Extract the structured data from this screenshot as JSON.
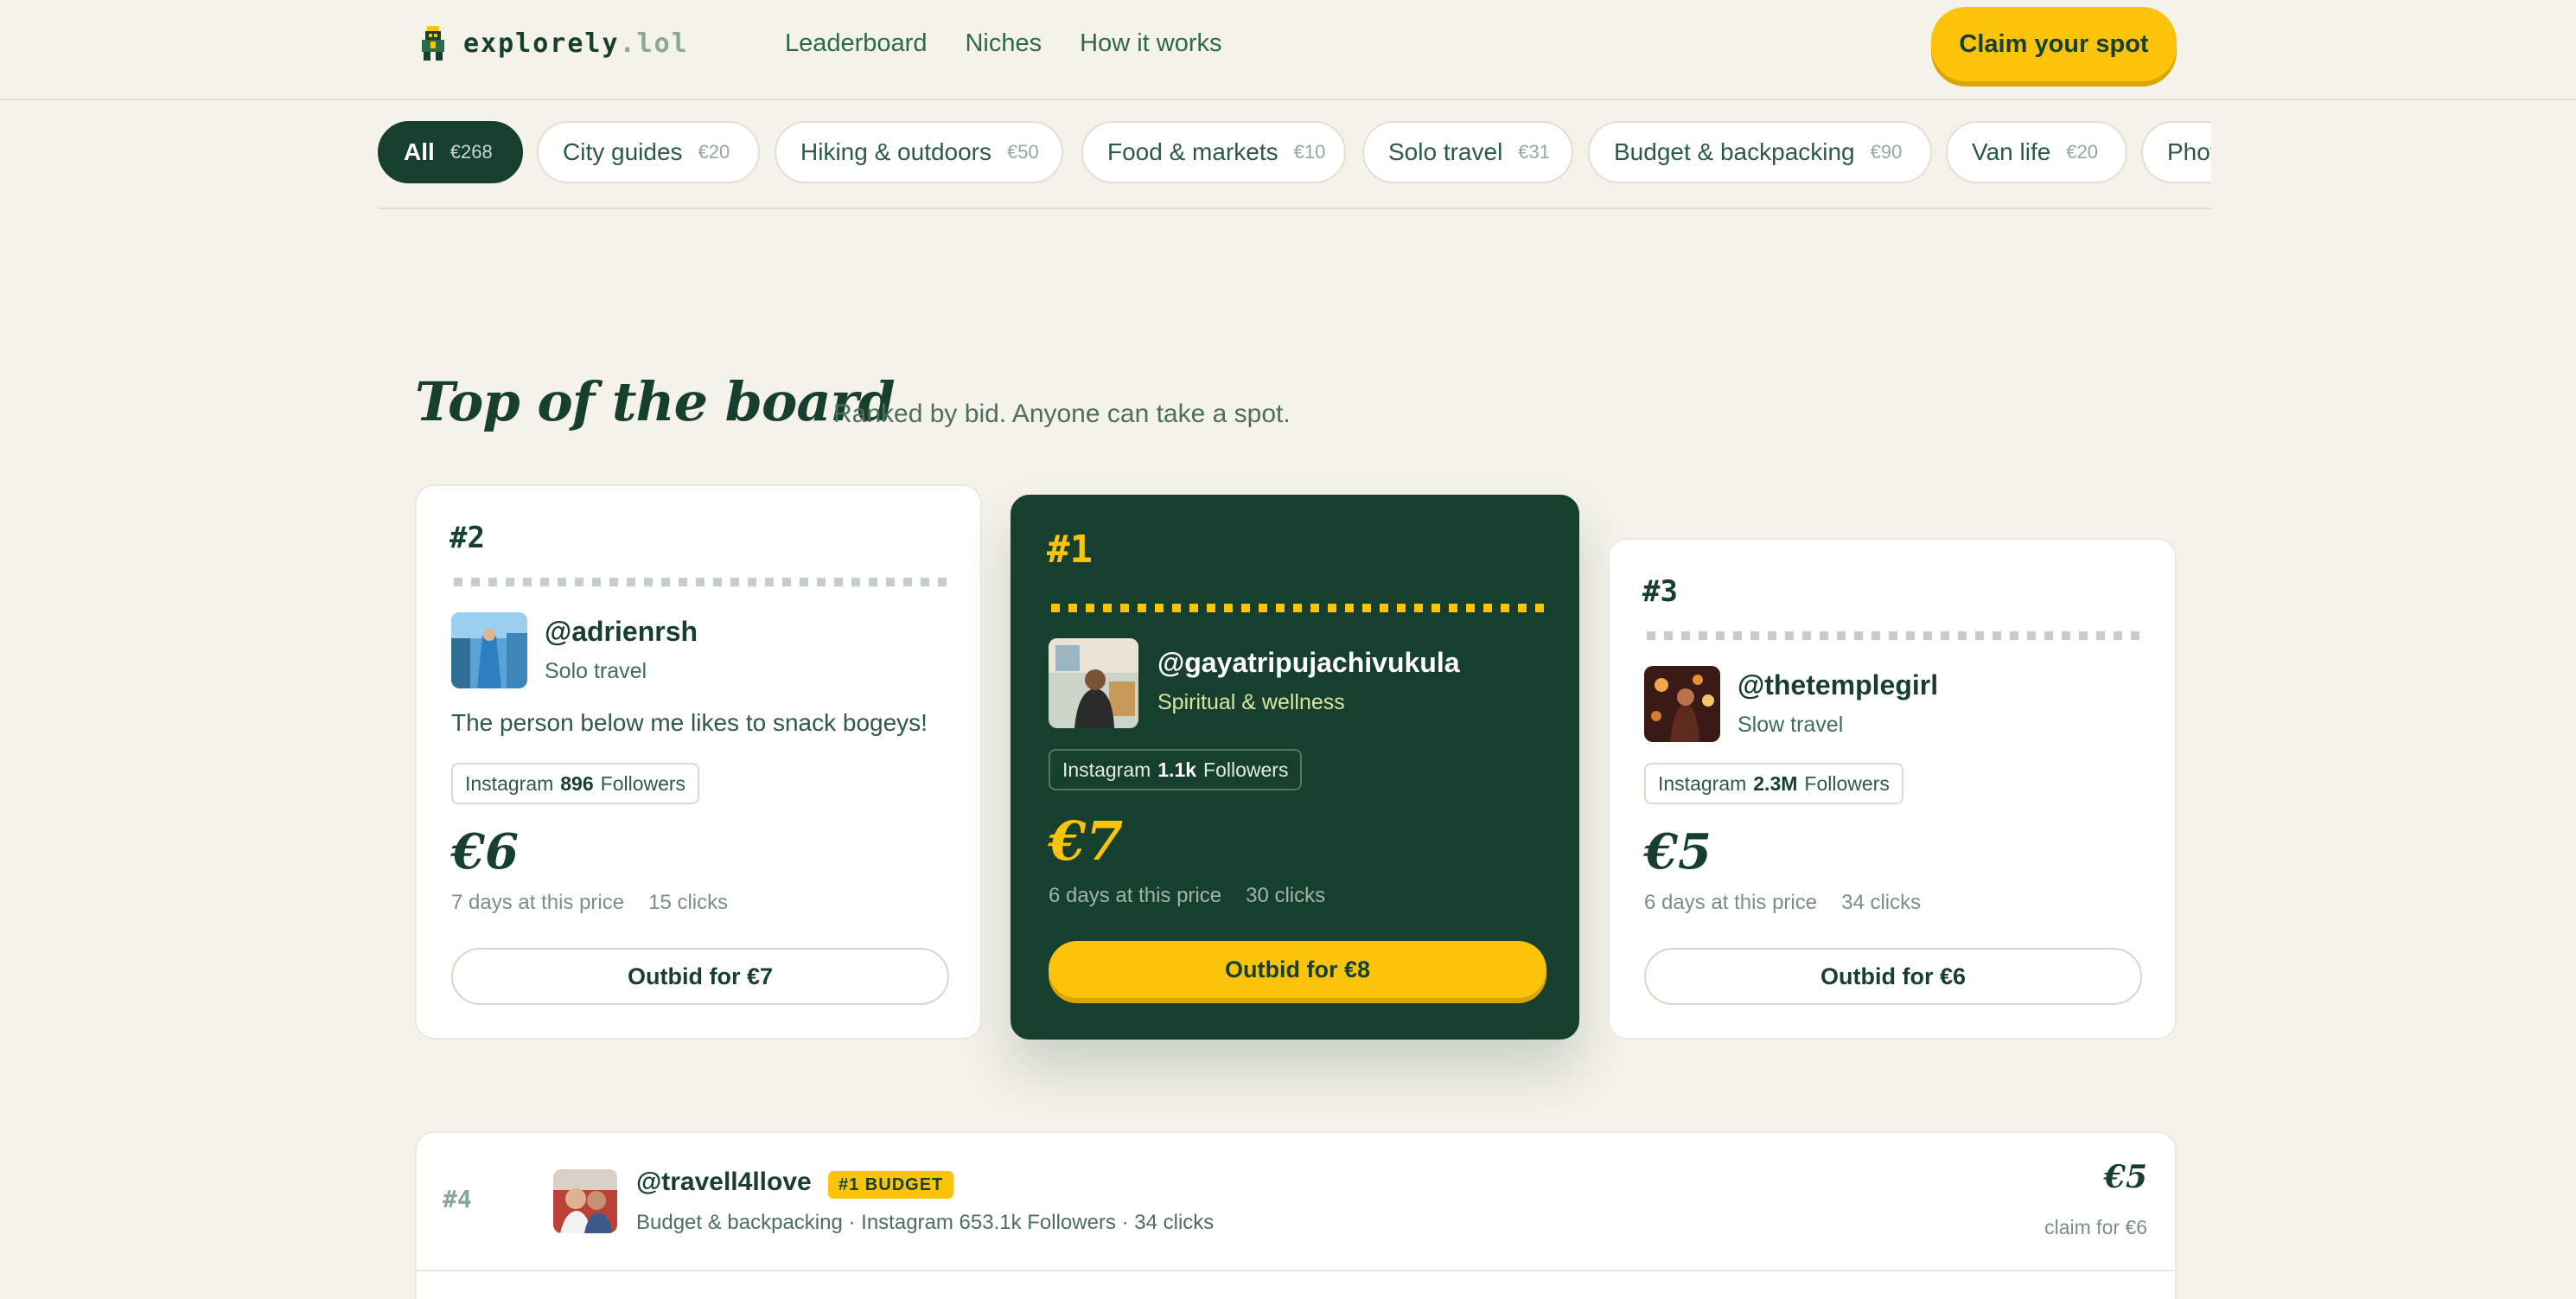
{
  "brand": {
    "name": "explorely",
    "tld": ".lol"
  },
  "nav": {
    "links": [
      "Leaderboard",
      "Niches",
      "How it works"
    ],
    "cta": "Claim your spot"
  },
  "filters": [
    {
      "label": "All",
      "amount": "€268",
      "active": true
    },
    {
      "label": "City guides",
      "amount": "€20"
    },
    {
      "label": "Hiking & outdoors",
      "amount": "€50"
    },
    {
      "label": "Food & markets",
      "amount": "€10"
    },
    {
      "label": "Solo travel",
      "amount": "€31"
    },
    {
      "label": "Budget & backpacking",
      "amount": "€90"
    },
    {
      "label": "Van life",
      "amount": "€20"
    },
    {
      "label": "Phot",
      "amount": ""
    }
  ],
  "section": {
    "title": "Top of the board",
    "subtitle": "Ranked by bid. Anyone can take a spot."
  },
  "podium": [
    {
      "rank": "#2",
      "handle": "@adrienrsh",
      "niche": "Solo travel",
      "quote": "The person below me likes to snack bogeys!",
      "platform": "Instagram",
      "followers": "896",
      "followers_label": "Followers",
      "price": "€6",
      "days": "7 days at this price",
      "clicks": "15 clicks",
      "button": "Outbid for €7"
    },
    {
      "rank": "#1",
      "handle": "@gayatripujachivukula",
      "niche": "Spiritual & wellness",
      "platform": "Instagram",
      "followers": "1.1k",
      "followers_label": "Followers",
      "price": "€7",
      "days": "6 days at this price",
      "clicks": "30 clicks",
      "button": "Outbid for €8"
    },
    {
      "rank": "#3",
      "handle": "@thetemplegirl",
      "niche": "Slow travel",
      "platform": "Instagram",
      "followers": "2.3M",
      "followers_label": "Followers",
      "price": "€5",
      "days": "6 days at this price",
      "clicks": "34 clicks",
      "button": "Outbid for €6"
    }
  ],
  "rows": [
    {
      "rank": "#4",
      "handle": "@travell4llove",
      "badge": "#1 BUDGET",
      "info": "Budget & backpacking · Instagram 653.1k Followers · 34 clicks",
      "price": "€5",
      "claim": "claim for €6"
    }
  ],
  "colors": {
    "primary": "#173f2e",
    "accent": "#fbc40a",
    "background": "#f4f2e9"
  }
}
